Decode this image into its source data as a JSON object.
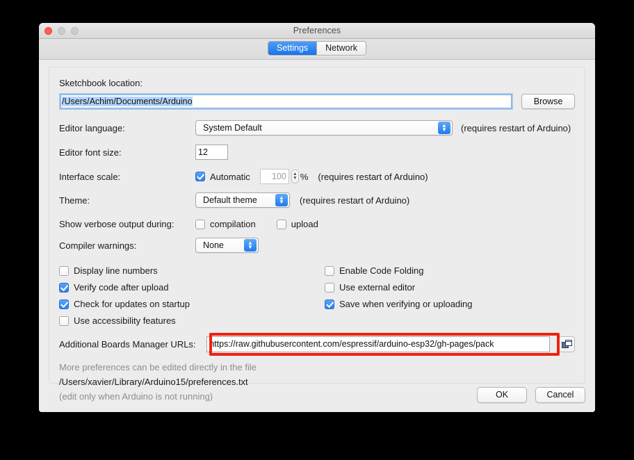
{
  "window": {
    "title": "Preferences",
    "traffic_lights": [
      "close-button",
      "minimize-button",
      "zoom-button"
    ]
  },
  "tabs": [
    {
      "label": "Settings",
      "active": true
    },
    {
      "label": "Network",
      "active": false
    }
  ],
  "settings": {
    "sketchbook": {
      "label": "Sketchbook location:",
      "value": "/Users/Achim/Documents/Arduino",
      "browse_label": "Browse"
    },
    "editor_language": {
      "label": "Editor language:",
      "value": "System Default",
      "note": "(requires restart of Arduino)"
    },
    "editor_font_size": {
      "label": "Editor font size:",
      "value": "12"
    },
    "interface_scale": {
      "label": "Interface scale:",
      "automatic_label": "Automatic",
      "automatic_checked": true,
      "scale_value": "100",
      "percent_label": "%",
      "note": "(requires restart of Arduino)"
    },
    "theme": {
      "label": "Theme:",
      "value": "Default theme",
      "note": "(requires restart of Arduino)"
    },
    "verbose": {
      "label": "Show verbose output during:",
      "compilation_label": "compilation",
      "compilation_checked": false,
      "upload_label": "upload",
      "upload_checked": false
    },
    "compiler_warnings": {
      "label": "Compiler warnings:",
      "value": "None"
    },
    "checkboxes_left": [
      {
        "label": "Display line numbers",
        "checked": false
      },
      {
        "label": "Verify code after upload",
        "checked": true
      },
      {
        "label": "Check for updates on startup",
        "checked": true
      },
      {
        "label": "Use accessibility features",
        "checked": false
      }
    ],
    "checkboxes_right": [
      {
        "label": "Enable Code Folding",
        "checked": false
      },
      {
        "label": "Use external editor",
        "checked": false
      },
      {
        "label": "Save when verifying or uploading",
        "checked": true
      }
    ],
    "boards_urls": {
      "label": "Additional Boards Manager URLs:",
      "value": "https://raw.githubusercontent.com/espressif/arduino-esp32/gh-pages/pack",
      "highlight_color": "#f02010"
    },
    "footnotes": {
      "line1": "More preferences can be edited directly in the file",
      "line2": "/Users/xavier/Library/Arduino15/preferences.txt",
      "line3": "(edit only when Arduino is not running)"
    }
  },
  "footer": {
    "ok_label": "OK",
    "cancel_label": "Cancel"
  }
}
